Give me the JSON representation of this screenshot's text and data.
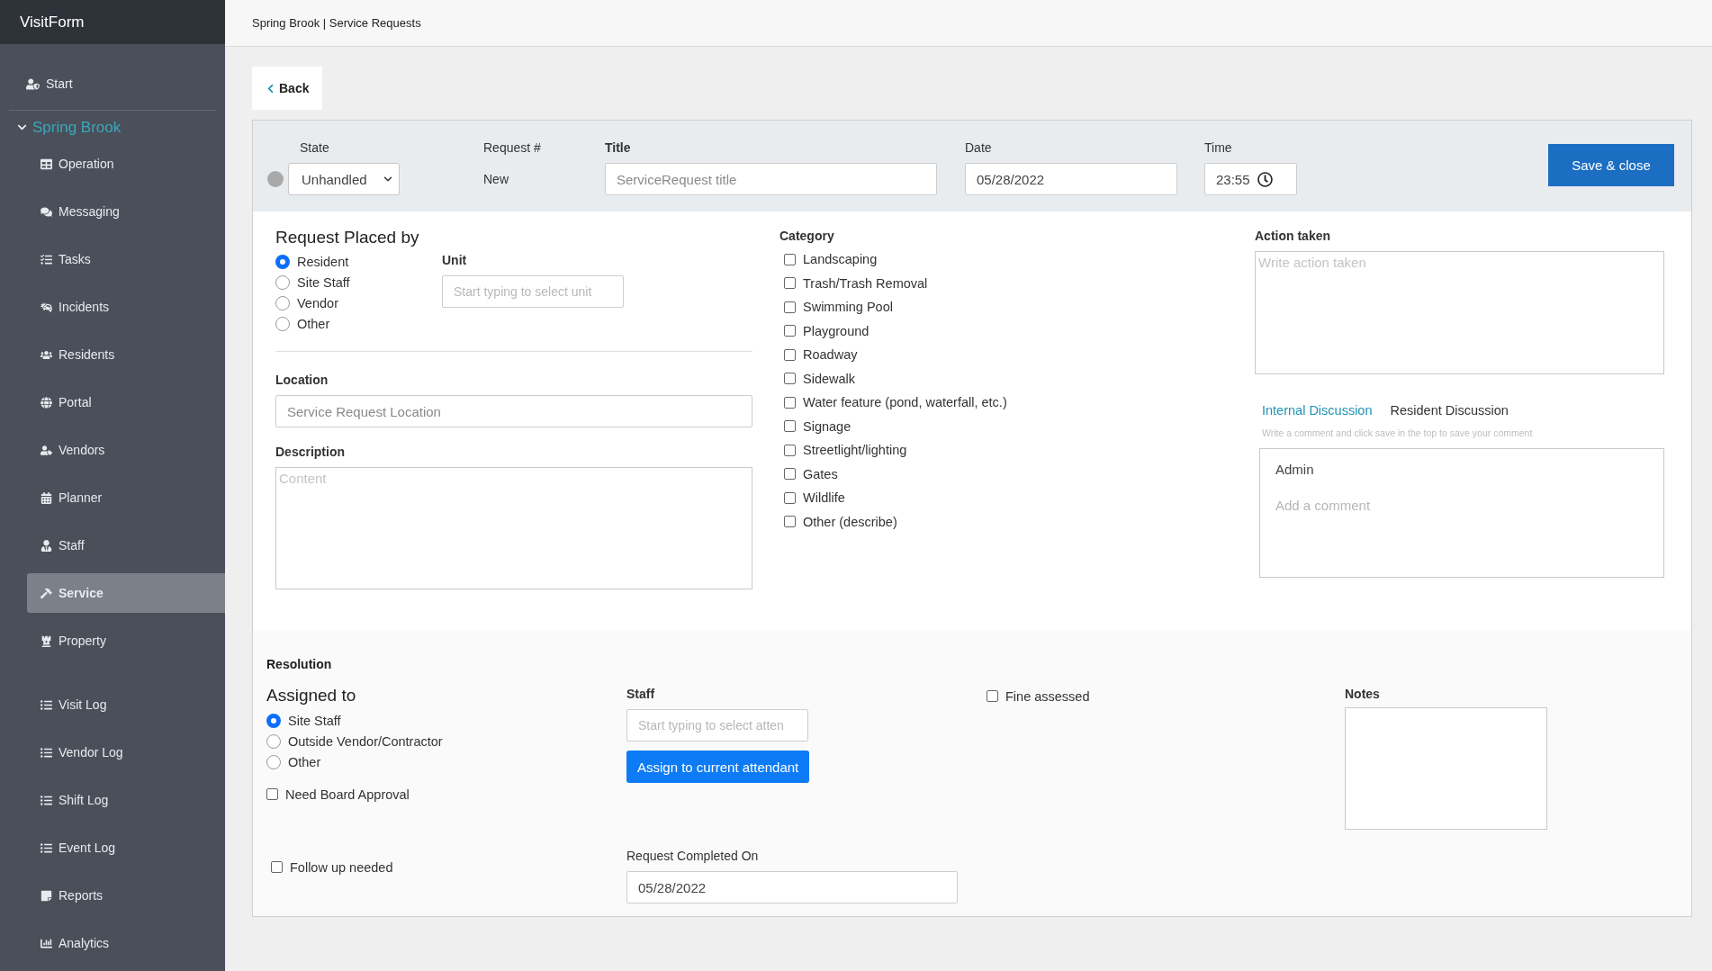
{
  "app": {
    "brand": "VisitForm"
  },
  "sidebar": {
    "start": {
      "label": "Start"
    },
    "group": {
      "label": "Spring Brook",
      "expanded": true
    },
    "items": [
      {
        "label": "Operation",
        "selected": false
      },
      {
        "label": "Messaging",
        "selected": false
      },
      {
        "label": "Tasks",
        "selected": false
      },
      {
        "label": "Incidents",
        "selected": false
      },
      {
        "label": "Residents",
        "selected": false
      },
      {
        "label": "Portal",
        "selected": false
      },
      {
        "label": "Vendors",
        "selected": false
      },
      {
        "label": "Planner",
        "selected": false
      },
      {
        "label": "Staff",
        "selected": false
      },
      {
        "label": "Service",
        "selected": true
      },
      {
        "label": "Property",
        "selected": false
      }
    ],
    "logs": [
      {
        "label": "Visit Log",
        "selected": false
      },
      {
        "label": "Vendor Log",
        "selected": false
      },
      {
        "label": "Shift Log",
        "selected": false
      },
      {
        "label": "Event Log",
        "selected": false
      },
      {
        "label": "Reports",
        "selected": false
      },
      {
        "label": "Analytics",
        "selected": false
      }
    ]
  },
  "breadcrumb": "Spring Brook | Service Requests",
  "back_button": "Back",
  "top": {
    "state_label": "State",
    "state_value": "Unhandled",
    "request_label": "Request #",
    "request_value": "New",
    "title_label": "Title",
    "title_placeholder": "ServiceRequest title",
    "date_label": "Date",
    "date_value": "05/28/2022",
    "time_label": "Time",
    "time_value": "23:55",
    "save_button": "Save & close"
  },
  "placed_by": {
    "heading": "Request Placed by",
    "options": [
      {
        "label": "Resident",
        "selected": true
      },
      {
        "label": "Site Staff",
        "selected": false
      },
      {
        "label": "Vendor",
        "selected": false
      },
      {
        "label": "Other",
        "selected": false
      }
    ],
    "unit_label": "Unit",
    "unit_placeholder": "Start typing to select unit"
  },
  "location": {
    "label": "Location",
    "placeholder": "Service Request Location"
  },
  "description": {
    "label": "Description",
    "placeholder": "Content"
  },
  "category": {
    "heading": "Category",
    "items": [
      {
        "label": "Landscaping",
        "checked": false
      },
      {
        "label": "Trash/Trash Removal",
        "checked": false
      },
      {
        "label": "Swimming Pool",
        "checked": false
      },
      {
        "label": "Playground",
        "checked": false
      },
      {
        "label": "Roadway",
        "checked": false
      },
      {
        "label": "Sidewalk",
        "checked": false
      },
      {
        "label": "Water feature (pond, waterfall, etc.)",
        "checked": false
      },
      {
        "label": "Signage",
        "checked": false
      },
      {
        "label": "Streetlight/lighting",
        "checked": false
      },
      {
        "label": "Gates",
        "checked": false
      },
      {
        "label": "Wildlife",
        "checked": false
      },
      {
        "label": "Other (describe)",
        "checked": false
      }
    ]
  },
  "action_taken": {
    "label": "Action taken",
    "placeholder": "Write action taken"
  },
  "discussion": {
    "tabs": [
      {
        "label": "Internal Discussion",
        "selected": true
      },
      {
        "label": "Resident Discussion",
        "selected": false
      }
    ],
    "hint": "Write a comment and click save in the top to save your comment",
    "author": "Admin",
    "placeholder": "Add a comment"
  },
  "resolution": {
    "heading": "Resolution",
    "assigned_heading": "Assigned to",
    "options": [
      {
        "label": "Site Staff",
        "selected": true
      },
      {
        "label": "Outside Vendor/Contractor",
        "selected": false
      },
      {
        "label": "Other",
        "selected": false
      }
    ],
    "need_board": {
      "label": "Need Board Approval",
      "checked": false
    },
    "follow_up": {
      "label": "Follow up needed",
      "checked": false
    },
    "staff_label": "Staff",
    "staff_placeholder": "Start typing to select atten",
    "assign_button": "Assign to current attendant",
    "fine": {
      "label": "Fine assessed",
      "checked": false
    },
    "notes_label": "Notes",
    "completed_label": "Request Completed On",
    "completed_value": "05/28/2022"
  }
}
